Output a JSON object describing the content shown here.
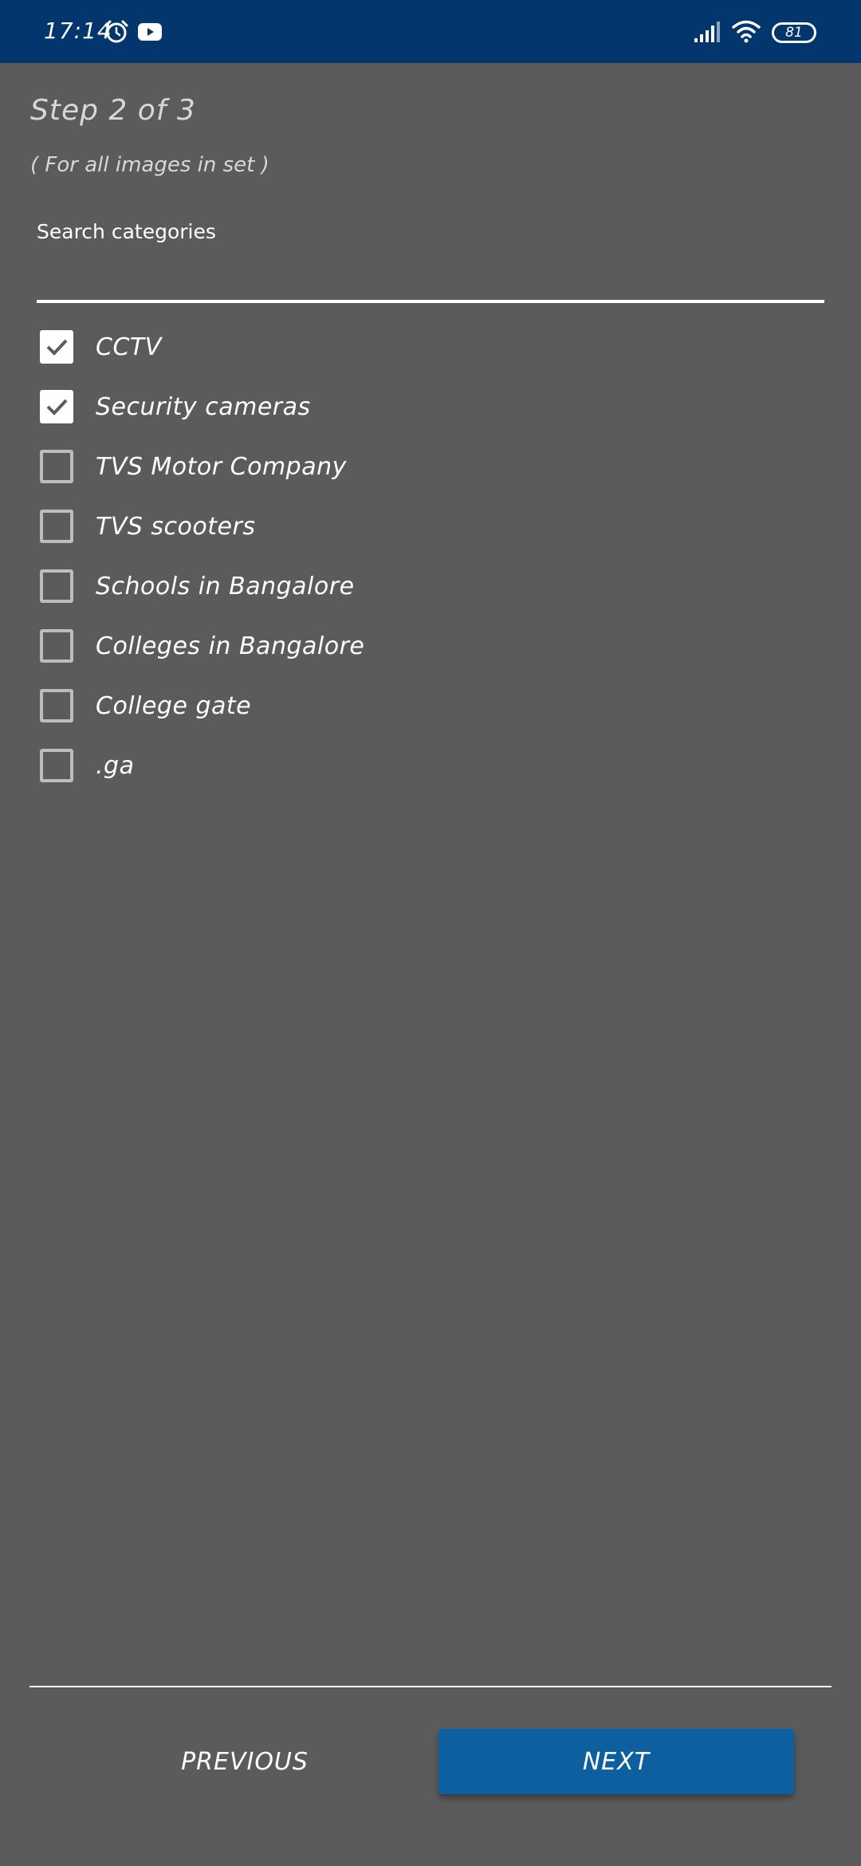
{
  "status_bar": {
    "time": "17:14",
    "battery": "81",
    "icons": [
      "alarm-icon",
      "youtube-icon",
      "signal-icon",
      "wifi-icon",
      "battery-icon"
    ]
  },
  "header": {
    "step_title": "Step 2 of 3",
    "subtitle": "( For all images in set )"
  },
  "search": {
    "label": "Search categories",
    "value": "",
    "placeholder": ""
  },
  "categories": [
    {
      "label": "CCTV",
      "checked": true
    },
    {
      "label": "Security cameras",
      "checked": true
    },
    {
      "label": "TVS Motor Company",
      "checked": false
    },
    {
      "label": "TVS scooters",
      "checked": false
    },
    {
      "label": "Schools in Bangalore",
      "checked": false
    },
    {
      "label": "Colleges in Bangalore",
      "checked": false
    },
    {
      "label": "College gate",
      "checked": false
    },
    {
      "label": ".ga",
      "checked": false
    }
  ],
  "footer": {
    "previous_label": "PREVIOUS",
    "next_label": "NEXT"
  },
  "colors": {
    "status_bar": "#02366d",
    "background": "#5b5b5b",
    "accent": "#0d5fa0"
  }
}
